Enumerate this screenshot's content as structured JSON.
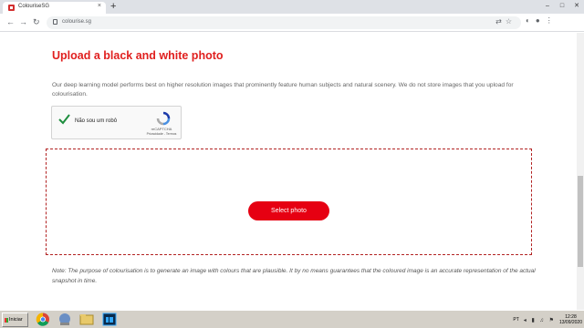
{
  "browser": {
    "tab_title": "ColouriseSG",
    "tab_close": "×",
    "newtab": "+",
    "url": "colourise.sg",
    "controls": {
      "minimize": "–",
      "maximize": "□",
      "close": "✕"
    },
    "nav": {
      "back": "←",
      "forward": "→",
      "reload": "↻"
    },
    "omni_icons": "⇄☆",
    "right_icons": {
      "extension": "◐",
      "profile": "●",
      "menu": "⋮"
    }
  },
  "page": {
    "heading": "Upload a black and white photo",
    "description": "Our deep learning model performs best on higher resolution images that prominently feature human subjects and natural scenery. We do not store images that you upload for colourisation.",
    "recaptcha": {
      "label": "Não sou um robô",
      "brand": "reCAPTCHA",
      "links": "Privacidade - Termos"
    },
    "select_button": "Select photo",
    "note": "Note: The purpose of colourisation is to generate an image with colours that are plausible. It by no means guarantees that the coloured image is an accurate representation of the actual snapshot in time."
  },
  "taskbar": {
    "start_label": "Iniciar",
    "language": "PT",
    "time": "12:28",
    "date": "13/09/2020"
  },
  "colors": {
    "accent": "#e60012",
    "heading": "#e0201f",
    "dropzone_border": "#b22222"
  }
}
